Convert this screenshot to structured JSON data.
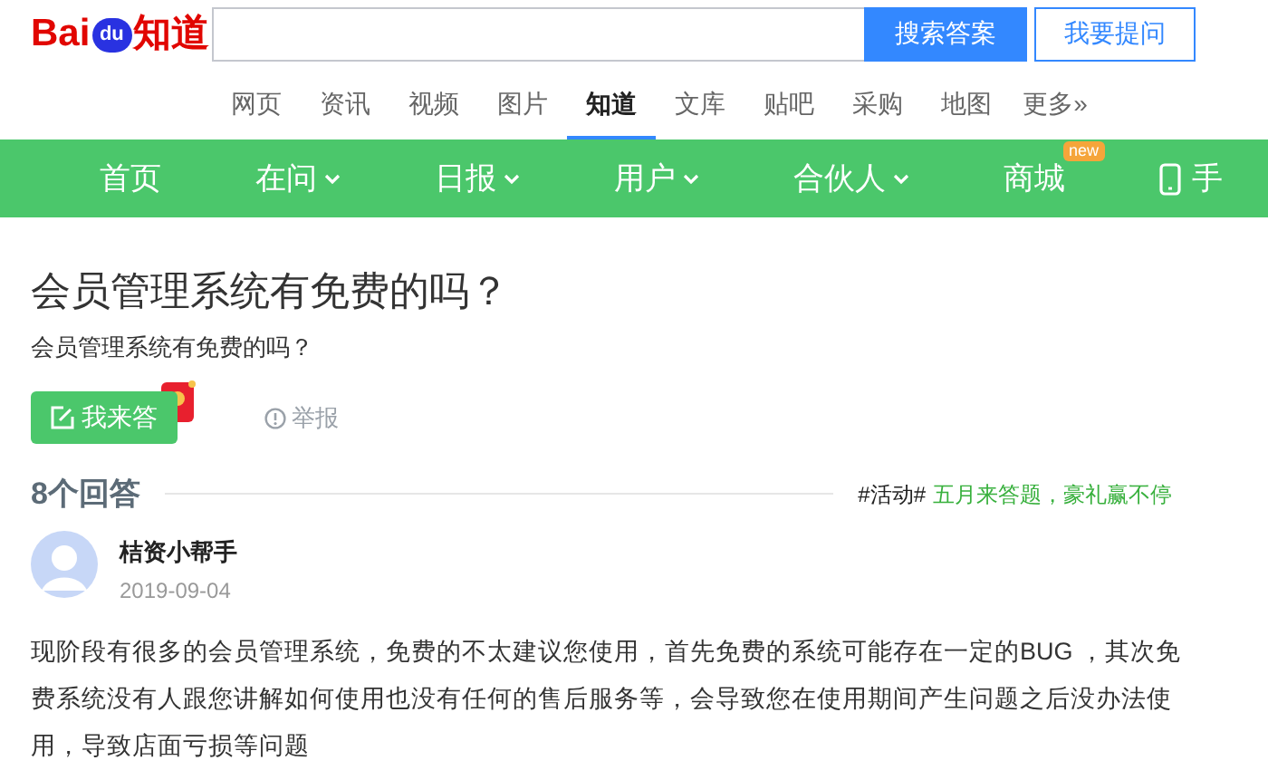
{
  "logo": {
    "left": "Bai",
    "paw": "du",
    "right": "知道"
  },
  "search": {
    "button": "搜索答案",
    "ask_button": "我要提问"
  },
  "channels": [
    {
      "label": "网页",
      "selected": false
    },
    {
      "label": "资讯",
      "selected": false
    },
    {
      "label": "视频",
      "selected": false
    },
    {
      "label": "图片",
      "selected": false
    },
    {
      "label": "知道",
      "selected": true
    },
    {
      "label": "文库",
      "selected": false
    },
    {
      "label": "贴吧",
      "selected": false
    },
    {
      "label": "采购",
      "selected": false
    },
    {
      "label": "地图",
      "selected": false
    },
    {
      "label": "更多»",
      "selected": false
    }
  ],
  "menu": [
    {
      "kind": "plain",
      "label": "首页"
    },
    {
      "kind": "dropdown",
      "label": "在问"
    },
    {
      "kind": "dropdown",
      "label": "日报"
    },
    {
      "kind": "dropdown",
      "label": "用户"
    },
    {
      "kind": "dropdown",
      "label": "合伙人"
    },
    {
      "kind": "badge",
      "label": "商城",
      "badge": "new"
    },
    {
      "kind": "phone",
      "label": "手"
    }
  ],
  "question": {
    "title": "会员管理系统有免费的吗？",
    "description": "会员管理系统有免费的吗？",
    "answer_button": "我来答",
    "report": "举报"
  },
  "answers": {
    "count": "8个回答",
    "activity_tag": "#活动#",
    "activity_text": "五月来答题，豪礼赢不停"
  },
  "answer": {
    "author": "桔资小帮手",
    "date": "2019-09-04",
    "text": "现阶段有很多的会员管理系统，免费的不太建议您使用，首先免费的系统可能存在一定的BUG ，其次免费系统没有人跟您讲解如何使用也没有任何的售后服务等，会导致您在使用期间产生问题之后没办法使用，导致店面亏损等问题"
  }
}
